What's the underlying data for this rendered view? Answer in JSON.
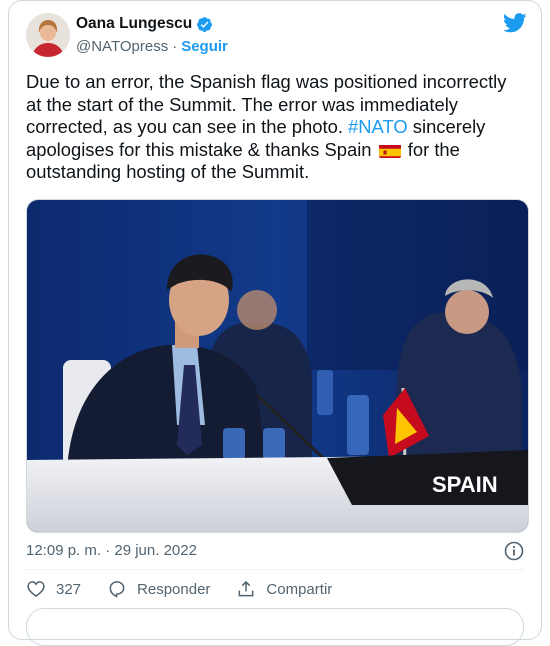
{
  "author": {
    "name": "Oana Lungescu",
    "handle": "@NATOpress",
    "separator": "·",
    "follow_label": "Seguir"
  },
  "tweet": {
    "text_1": "Due to an error, the Spanish flag was positioned incorrectly at the start of the Summit. The error was immediately corrected, as you can see in the photo. ",
    "hashtag": "#NATO",
    "text_2": " sincerely apologises for this mistake & thanks Spain ",
    "flag_emoji": "spain-flag",
    "text_3": " for the outstanding hosting of the Summit."
  },
  "photo": {
    "placard_text": "SPAIN"
  },
  "timestamp": "12:09 p. m. · 29 jun. 2022",
  "actions": {
    "likes_count": "327",
    "reply_label": "Responder",
    "share_label": "Compartir"
  },
  "icons": {
    "brand": "twitter-bird-icon",
    "verified": "verified-badge-icon",
    "info": "info-icon",
    "like": "heart-icon",
    "reply": "reply-bubble-icon",
    "share": "share-icon"
  },
  "colors": {
    "accent": "#1d9bf0",
    "text": "#0f1419",
    "muted": "#536471",
    "border": "#cfd9de"
  }
}
